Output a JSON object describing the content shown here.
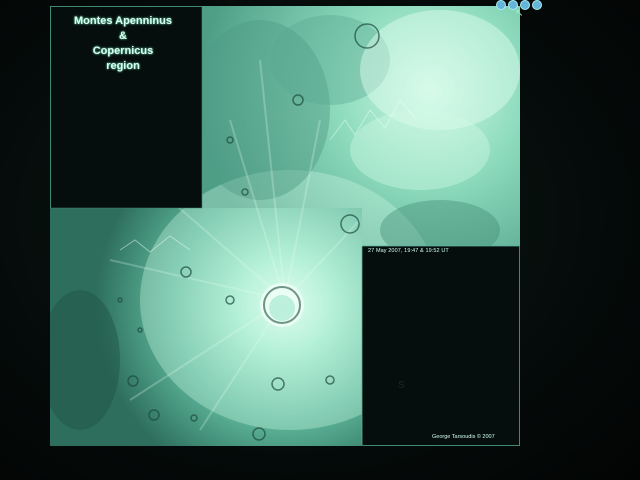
{
  "title_lines": [
    "Montes Apenninus",
    "&",
    "Copernicus",
    "region"
  ],
  "date_caption": "27 May 2007, 19:47 & 19:52 UT",
  "credit": "George Tarsoudis © 2007",
  "icons": [
    "window-button-1",
    "window-button-2",
    "window-button-3",
    "window-button-4"
  ],
  "colors": {
    "moon_light": "#d8fbe8",
    "moon_mid": "#7fd8b8",
    "moon_dark": "#2a6a58",
    "background": "#040a08"
  }
}
